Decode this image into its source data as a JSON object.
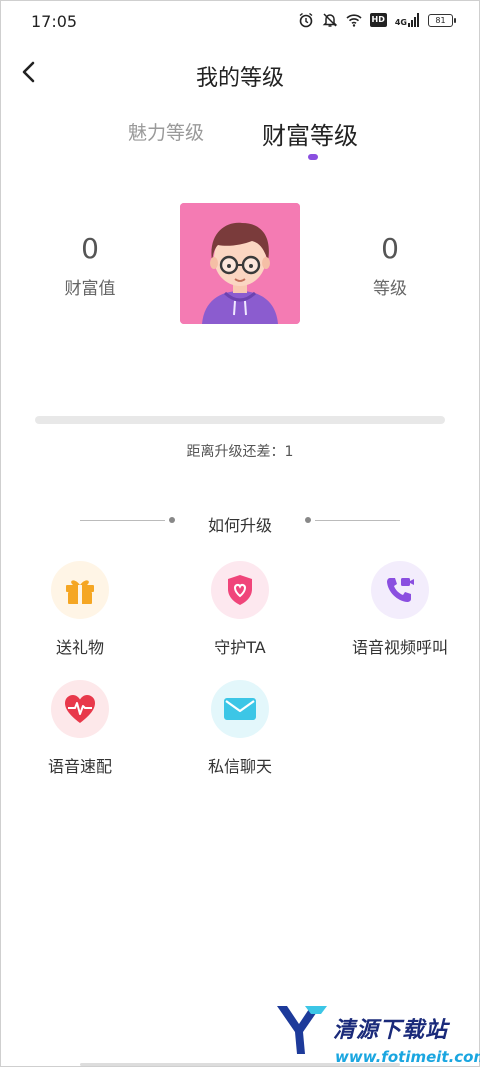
{
  "status_bar": {
    "time": "17:05",
    "hd": "HD",
    "network": "4G",
    "battery": "81"
  },
  "header": {
    "title": "我的等级"
  },
  "tabs": [
    {
      "label": "魅力等级",
      "active": false
    },
    {
      "label": "财富等级",
      "active": true
    }
  ],
  "stats": {
    "wealth_value": "0",
    "wealth_label": "财富值",
    "level_value": "0",
    "level_label": "等级"
  },
  "progress": {
    "fraction": 0.0
  },
  "distance_text": "距离升级还差：1",
  "howto_title": "如何升级",
  "features": [
    {
      "label": "送礼物",
      "icon": "gift-icon"
    },
    {
      "label": "守护TA",
      "icon": "shield-heart-icon"
    },
    {
      "label": "语音视频呼叫",
      "icon": "phone-video-icon"
    },
    {
      "label": "语音速配",
      "icon": "heart-pulse-icon"
    },
    {
      "label": "私信聊天",
      "icon": "mail-icon"
    }
  ],
  "watermark": {
    "name": "清源下载站",
    "url": "www.fotimeit.com"
  },
  "colors": {
    "accent": "#8a4fe0",
    "avatar_bg": "#f47bb3",
    "gift": "#f5a623",
    "shield": "#f0457a",
    "phone": "#8a4fe0",
    "heart": "#e8394b",
    "mail": "#3cc6e6"
  }
}
